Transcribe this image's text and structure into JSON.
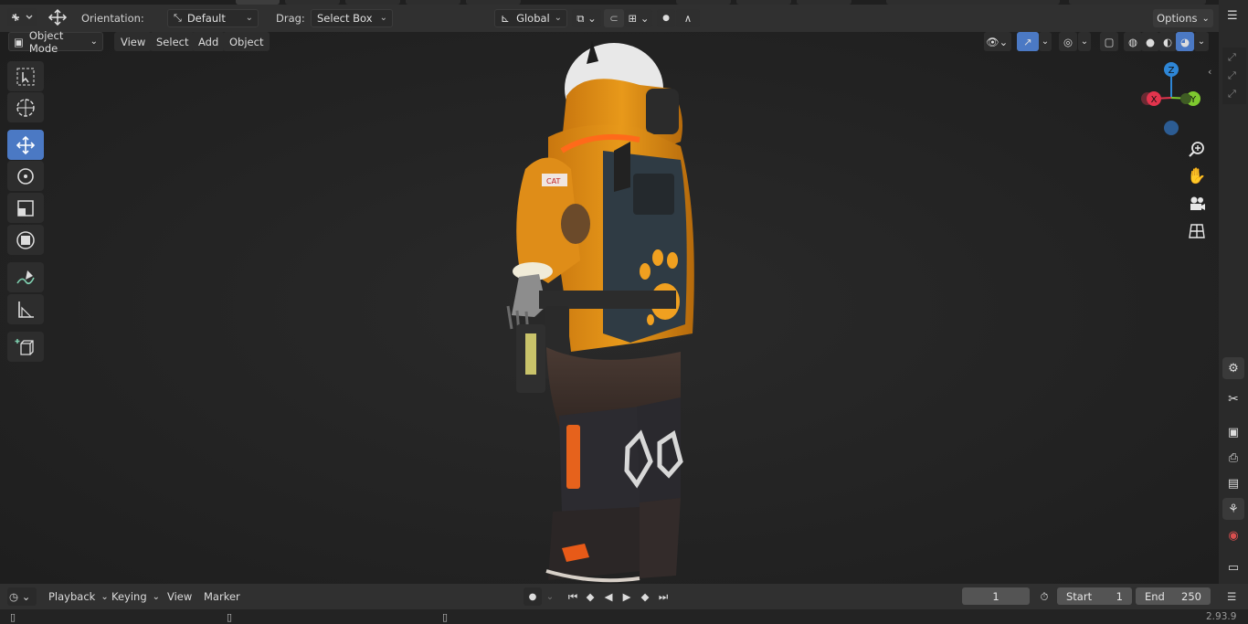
{
  "header": {
    "orientation_label": "Orientation:",
    "orientation_value": "Default",
    "drag_label": "Drag:",
    "drag_value": "Select Box",
    "transform_orientation": "Global",
    "options_label": "Options"
  },
  "viewport_header": {
    "mode": "Object Mode",
    "menus": [
      "View",
      "Select",
      "Add",
      "Object"
    ]
  },
  "gizmo": {
    "z": "Z",
    "x": "X",
    "y": "Y"
  },
  "timeline": {
    "menus": [
      "Playback",
      "Keying",
      "View",
      "Marker"
    ],
    "current_frame": "1",
    "start_label": "Start",
    "start_value": "1",
    "end_label": "End",
    "end_value": "250"
  },
  "status": {
    "version": "2.93.9"
  },
  "colors": {
    "accent": "#4b79c4",
    "axis_x": "#e2344d",
    "axis_y": "#7ec92f",
    "axis_z": "#2e86d6"
  },
  "icons": {
    "toolbar": [
      "select-box-icon",
      "cursor-icon",
      "move-icon",
      "rotate-icon",
      "scale-icon",
      "transform-icon",
      "annotate-icon",
      "measure-icon",
      "add-cube-icon"
    ],
    "nav": [
      "zoom-icon",
      "hand-pan-icon",
      "camera-icon",
      "grid-icon"
    ],
    "properties": [
      "tool-icon",
      "render-icon",
      "output-icon",
      "view-layer-icon",
      "scene-icon",
      "world-icon",
      "collection-icon"
    ]
  }
}
